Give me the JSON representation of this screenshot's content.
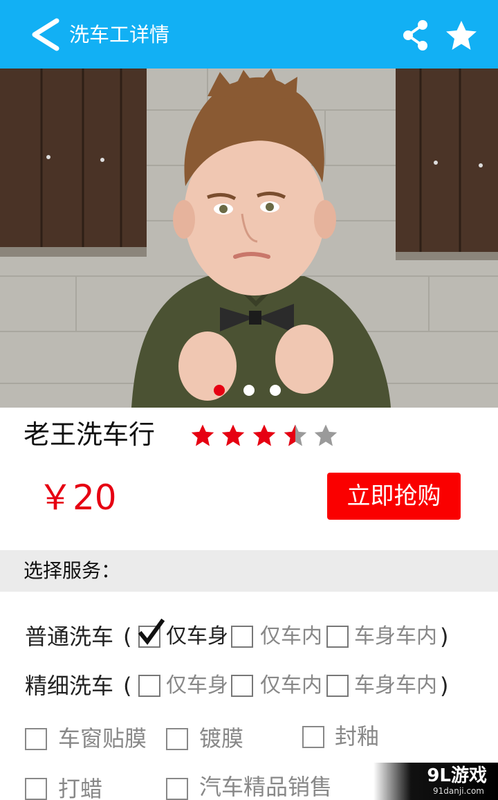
{
  "header": {
    "title": "洗车工详情",
    "back_icon": "chevron-left-icon",
    "share_icon": "share-icon",
    "favorite_icon": "star-icon",
    "background_color": "#12b0f4"
  },
  "banner": {
    "slide_count": 3,
    "active_slide": 1,
    "active_dot_color": "#e60012"
  },
  "shop": {
    "name": "老王洗车行",
    "rating": 3.5,
    "rating_max": 5,
    "price": "￥20",
    "buy_label": "立即抢购",
    "accent_color": "#fa0000"
  },
  "services": {
    "section_title": "选择服务：",
    "rows": [
      {
        "label": "普通洗车",
        "open_paren": "(",
        "close_paren": ")",
        "options": [
          {
            "label": "仅车身",
            "checked": true
          },
          {
            "label": "仅车内",
            "checked": false
          },
          {
            "label": "车身车内",
            "checked": false
          }
        ]
      },
      {
        "label": "精细洗车",
        "open_paren": "(",
        "close_paren": ")",
        "options": [
          {
            "label": "仅车身",
            "checked": false
          },
          {
            "label": "仅车内",
            "checked": false
          },
          {
            "label": "车身车内",
            "checked": false
          }
        ]
      }
    ],
    "extras": [
      {
        "label": "车窗贴膜",
        "checked": false
      },
      {
        "label": "镀膜",
        "checked": false
      },
      {
        "label": "封釉",
        "checked": false
      },
      {
        "label": "打蜡",
        "checked": false
      },
      {
        "label": "汽车精品销售",
        "checked": false
      }
    ]
  },
  "watermark": {
    "text": "9L游戏",
    "sub": "91danji.com"
  }
}
